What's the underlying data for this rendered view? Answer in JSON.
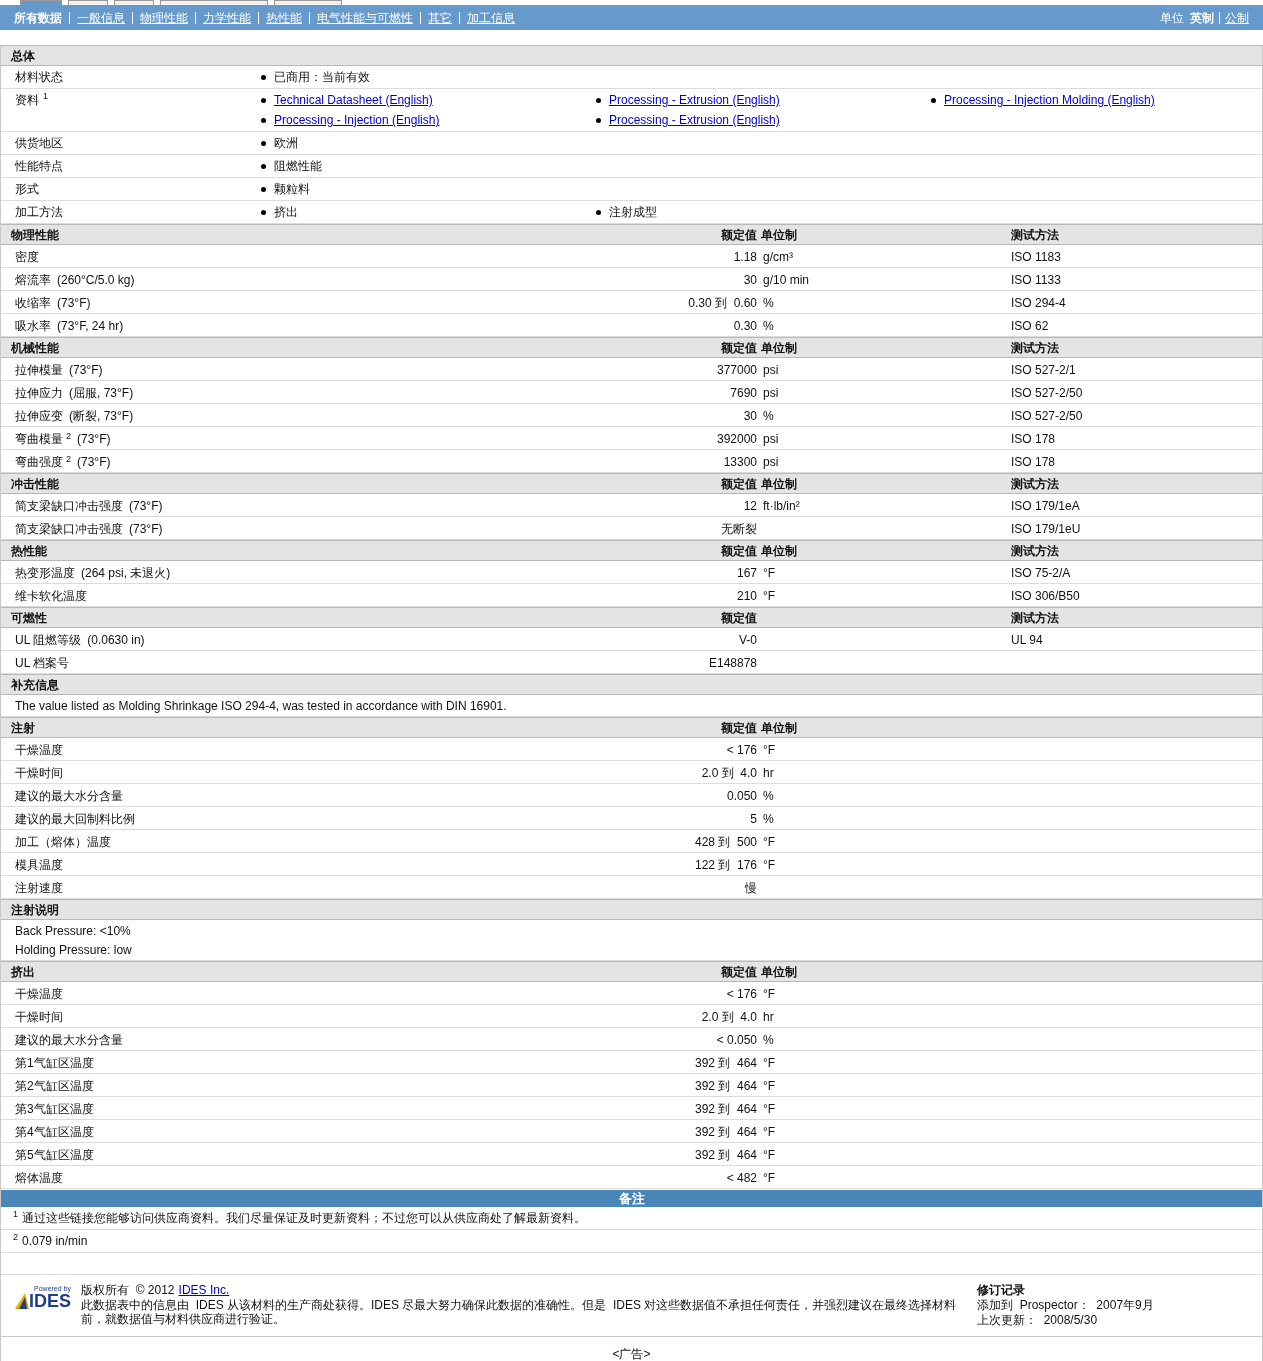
{
  "nav": {
    "tabs": [
      {
        "label": "所有数据",
        "selected": true
      },
      {
        "label": "一般信息",
        "selected": false
      },
      {
        "label": "物理性能",
        "selected": false
      },
      {
        "label": "力学性能",
        "selected": false
      },
      {
        "label": "热性能",
        "selected": false
      },
      {
        "label": "电气性能与可燃性",
        "selected": false
      },
      {
        "label": "其它",
        "selected": false
      },
      {
        "label": "加工信息",
        "selected": false
      }
    ],
    "units": {
      "label": "单位",
      "options": [
        {
          "label": "英制",
          "selected": true
        },
        {
          "label": "公制",
          "selected": false
        }
      ]
    }
  },
  "general": {
    "title": "总体",
    "rows": [
      {
        "label": "材料状态",
        "items": [
          {
            "text": "已商用：当前有效",
            "kind": "text"
          }
        ]
      },
      {
        "label": "资料",
        "note": "1",
        "items": [
          {
            "text": "Technical Datasheet (English)",
            "kind": "link"
          },
          {
            "text": "Processing - Extrusion (English)",
            "kind": "link"
          },
          {
            "text": "Processing - Injection Molding (English)",
            "kind": "link"
          },
          {
            "text": "Processing - Injection (English)",
            "kind": "link"
          },
          {
            "text": "Processing - Extrusion (English)",
            "kind": "link"
          }
        ]
      },
      {
        "label": "供货地区",
        "items": [
          {
            "text": "欧洲",
            "kind": "text"
          }
        ]
      },
      {
        "label": "性能特点",
        "items": [
          {
            "text": "阻燃性能",
            "kind": "text"
          }
        ]
      },
      {
        "label": "形式",
        "items": [
          {
            "text": "颗粒料",
            "kind": "text"
          }
        ]
      },
      {
        "label": "加工方法",
        "items": [
          {
            "text": "挤出",
            "kind": "text"
          },
          {
            "text": "注射成型",
            "kind": "text"
          }
        ]
      }
    ]
  },
  "sections": [
    {
      "kind": "table",
      "title": "物理性能",
      "value_header": "额定值",
      "unit_header": "单位制",
      "method_header": "测试方法",
      "rows": [
        {
          "label": "密度",
          "value": "1.18",
          "unit": "g/cm³",
          "method": "ISO 1183"
        },
        {
          "label": "熔流率",
          "condition": "(260°C/5.0 kg)",
          "value": "30",
          "unit": "g/10 min",
          "method": "ISO 1133"
        },
        {
          "label": "收缩率",
          "condition": "(73°F)",
          "value": "0.30 到  0.60",
          "unit": "%",
          "method": "ISO 294-4"
        },
        {
          "label": "吸水率",
          "condition": "(73°F, 24 hr)",
          "value": "0.30",
          "unit": "%",
          "method": "ISO 62"
        }
      ]
    },
    {
      "kind": "table",
      "title": "机械性能",
      "value_header": "额定值",
      "unit_header": "单位制",
      "method_header": "测试方法",
      "rows": [
        {
          "label": "拉伸模量",
          "condition": "(73°F)",
          "value": "377000",
          "unit": "psi",
          "method": "ISO 527-2/1"
        },
        {
          "label": "拉伸应力",
          "condition": "(屈服, 73°F)",
          "value": "7690",
          "unit": "psi",
          "method": "ISO 527-2/50"
        },
        {
          "label": "拉伸应变",
          "condition": "(断裂, 73°F)",
          "value": "30",
          "unit": "%",
          "method": "ISO 527-2/50"
        },
        {
          "label": "弯曲模量",
          "note": "2",
          "condition": "(73°F)",
          "value": "392000",
          "unit": "psi",
          "method": "ISO 178"
        },
        {
          "label": "弯曲强度",
          "note": "2",
          "condition": "(73°F)",
          "value": "13300",
          "unit": "psi",
          "method": "ISO 178"
        }
      ]
    },
    {
      "kind": "table",
      "title": "冲击性能",
      "value_header": "额定值",
      "unit_header": "单位制",
      "method_header": "测试方法",
      "rows": [
        {
          "label": "简支梁缺口冲击强度",
          "condition": "(73°F)",
          "value": "12",
          "unit": "ft·lb/in²",
          "method": "ISO 179/1eA"
        },
        {
          "label": "简支梁缺口冲击强度",
          "condition": "(73°F)",
          "value": "无断裂",
          "method": "ISO 179/1eU"
        }
      ]
    },
    {
      "kind": "table",
      "title": "热性能",
      "value_header": "额定值",
      "unit_header": "单位制",
      "method_header": "测试方法",
      "rows": [
        {
          "label": "热变形温度",
          "condition": "(264 psi, 未退火)",
          "value": "167",
          "unit": "°F",
          "method": "ISO 75-2/A"
        },
        {
          "label": "维卡软化温度",
          "value": "210",
          "unit": "°F",
          "method": "ISO 306/B50"
        }
      ]
    },
    {
      "kind": "table",
      "title": "可燃性",
      "value_header": "额定值",
      "method_header": "测试方法",
      "rows": [
        {
          "label": "UL 阻燃等级",
          "condition": "(0.0630 in)",
          "value": "V-0",
          "method": "UL 94"
        },
        {
          "label": "UL 档案号",
          "value": "E148878"
        }
      ]
    },
    {
      "kind": "text",
      "title": "补充信息",
      "lines": [
        "The value listed as Molding Shrinkage ISO 294-4, was tested in accordance with DIN 16901."
      ]
    },
    {
      "kind": "table",
      "title": "注射",
      "value_header": "额定值",
      "unit_header": "单位制",
      "rows": [
        {
          "label": "干燥温度",
          "value": "< 176",
          "unit": "°F"
        },
        {
          "label": "干燥时间",
          "value": "2.0 到  4.0",
          "unit": "hr"
        },
        {
          "label": "建议的最大水分含量",
          "value": "0.050",
          "unit": "%"
        },
        {
          "label": "建议的最大回制料比例",
          "value": "5",
          "unit": "%"
        },
        {
          "label": "加工（熔体）温度",
          "value": "428 到  500",
          "unit": "°F"
        },
        {
          "label": "模具温度",
          "value": "122 到  176",
          "unit": "°F"
        },
        {
          "label": "注射速度",
          "value": "慢"
        }
      ]
    },
    {
      "kind": "text",
      "title": "注射说明",
      "lines": [
        "Back Pressure: <10%",
        "Holding Pressure: low"
      ]
    },
    {
      "kind": "table",
      "title": "挤出",
      "value_header": "额定值",
      "unit_header": "单位制",
      "rows": [
        {
          "label": "干燥温度",
          "value": "< 176",
          "unit": "°F"
        },
        {
          "label": "干燥时间",
          "value": "2.0 到  4.0",
          "unit": "hr"
        },
        {
          "label": "建议的最大水分含量",
          "value": "< 0.050",
          "unit": "%"
        },
        {
          "label": "第1气缸区温度",
          "value": "392 到  464",
          "unit": "°F"
        },
        {
          "label": "第2气缸区温度",
          "value": "392 到  464",
          "unit": "°F"
        },
        {
          "label": "第3气缸区温度",
          "value": "392 到  464",
          "unit": "°F"
        },
        {
          "label": "第4气缸区温度",
          "value": "392 到  464",
          "unit": "°F"
        },
        {
          "label": "第5气缸区温度",
          "value": "392 到  464",
          "unit": "°F"
        },
        {
          "label": "熔体温度",
          "value": "< 482",
          "unit": "°F"
        }
      ]
    }
  ],
  "remarks": {
    "title": "备注",
    "footnotes": [
      {
        "mark": "1",
        "text": "通过这些链接您能够访问供应商资料。我们尽量保证及时更新资料；不过您可以从供应商处了解最新资料。"
      },
      {
        "mark": "2",
        "text": "0.079 in/min"
      }
    ]
  },
  "footer": {
    "logo_small": "Powered by",
    "logo_big": "IDES",
    "copyright": "版权所有  © 2012",
    "company_link": "IDES Inc.",
    "disclaimer": "此数据表中的信息由  IDES 从该材料的生产商处获得。IDES 尽最大努力确保此数据的准确性。但是  IDES 对这些数据值不承担任何责任，并强烈建议在最终选择材料前，就数据值与材料供应商进行验证。",
    "history_title": "修订记录",
    "history": [
      "添加到  Prospector：  2007年9月",
      "上次更新：  2008/5/30"
    ]
  },
  "ad": "<广告>"
}
